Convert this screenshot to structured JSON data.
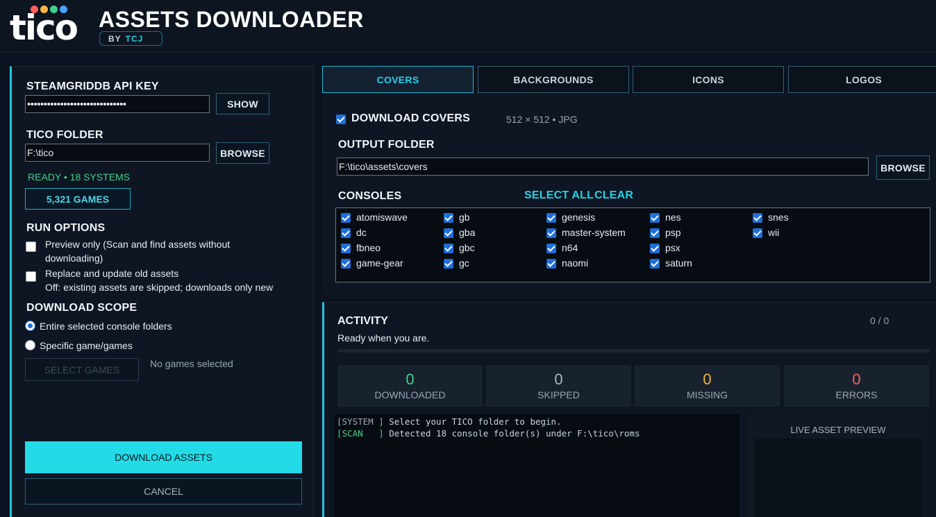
{
  "header": {
    "logo_text": "tico",
    "logo_dot_colors": [
      "#ff5c5c",
      "#ffb547",
      "#3fd18c",
      "#4aa3ff"
    ],
    "title": "ASSETS DOWNLOADER",
    "by_label": "BY",
    "by_name": "TCJ"
  },
  "left": {
    "api_key_label": "STEAMGRIDDB API KEY",
    "api_key_value": "••••••••••••••••••••••••••••••",
    "show_button": "SHOW",
    "tico_folder_label": "TICO FOLDER",
    "tico_folder_value": "F:\\tico",
    "browse_button": "BROWSE",
    "status_ready": "READY",
    "status_systems": "18 SYSTEMS",
    "games_count": "5,321 GAMES",
    "run_options_label": "RUN OPTIONS",
    "preview_only_line1": "Preview only (Scan and find assets without",
    "preview_only_line2": "downloading)",
    "replace_line1": "Replace and update old assets",
    "replace_line2": "Off: existing assets are skipped; downloads only new",
    "scope_label": "DOWNLOAD SCOPE",
    "scope_entire": "Entire selected console folders",
    "scope_specific": "Specific game/games",
    "select_games_button": "SELECT GAMES",
    "no_games": "No games selected",
    "download_button": "DOWNLOAD ASSETS",
    "cancel_button": "CANCEL"
  },
  "tabs": [
    {
      "label": "COVERS",
      "active": true
    },
    {
      "label": "BACKGROUNDS",
      "active": false
    },
    {
      "label": "ICONS",
      "active": false
    },
    {
      "label": "LOGOS",
      "active": false
    }
  ],
  "covers": {
    "download_label": "DOWNLOAD COVERS",
    "spec": "512 × 512 • JPG",
    "output_label": "OUTPUT FOLDER",
    "output_value": "F:\\tico\\assets\\covers",
    "browse_button": "BROWSE",
    "consoles_label": "CONSOLES",
    "select_all": "SELECT ALL",
    "clear": "CLEAR",
    "consoles": [
      [
        "atomiswave",
        "dc",
        "fbneo",
        "game-gear"
      ],
      [
        "gb",
        "gba",
        "gbc",
        "gc"
      ],
      [
        "genesis",
        "master-system",
        "n64",
        "naomi"
      ],
      [
        "nes",
        "psp",
        "psx",
        "saturn"
      ],
      [
        "snes",
        "wii"
      ]
    ]
  },
  "activity": {
    "title": "ACTIVITY",
    "subtitle": "Ready when you are.",
    "count": "0 / 0",
    "progress": 0,
    "stats": [
      {
        "value": "0",
        "label": "DOWNLOADED",
        "color": "#3fd18c"
      },
      {
        "value": "0",
        "label": "SKIPPED",
        "color": "#aab6c2"
      },
      {
        "value": "0",
        "label": "MISSING",
        "color": "#f5b13a"
      },
      {
        "value": "0",
        "label": "ERRORS",
        "color": "#f06464"
      }
    ],
    "log": [
      {
        "tag": "[SYSTEM ]",
        "text": " Select your TICO folder to begin."
      },
      {
        "tag": "[SCAN   ]",
        "text": " Detected 18 console folder(s) under F:\\tico\\roms"
      }
    ],
    "preview_title": "LIVE ASSET PREVIEW"
  }
}
